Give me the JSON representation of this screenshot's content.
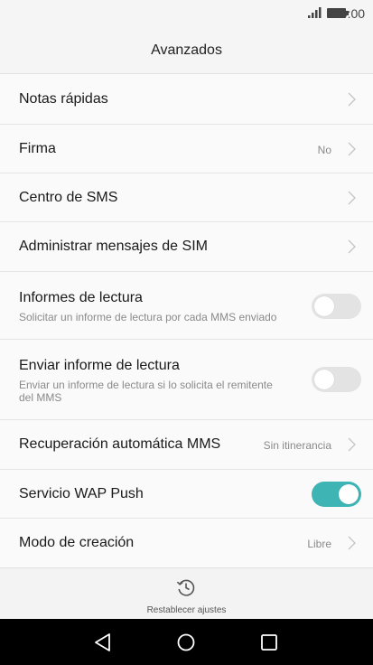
{
  "status_bar": {
    "time": "10:00"
  },
  "header": {
    "title": "Avanzados"
  },
  "settings": {
    "notas": {
      "label": "Notas rápidas"
    },
    "firma": {
      "label": "Firma",
      "value": "No"
    },
    "centro_sms": {
      "label": "Centro de SMS"
    },
    "admin_sim": {
      "label": "Administrar mensajes de SIM"
    },
    "informes": {
      "label": "Informes de lectura",
      "description": "Solicitar un informe de lectura por cada MMS enviado",
      "enabled": false
    },
    "enviar_informe": {
      "label": "Enviar informe de lectura",
      "description": "Enviar un informe de lectura si lo solicita el remitente del MMS",
      "enabled": false
    },
    "recuperacion": {
      "label": "Recuperación automática MMS",
      "value": "Sin itinerancia"
    },
    "wap_push": {
      "label": "Servicio WAP Push",
      "enabled": true
    },
    "modo_creacion": {
      "label": "Modo de creación",
      "value": "Libre"
    }
  },
  "footer": {
    "reset_label": "Restablecer ajustes"
  },
  "colors": {
    "accent": "#3eb4b4",
    "toggle_off": "#e3e3e3"
  },
  "icons": [
    "signal-icon",
    "battery-icon",
    "chevron-right-icon",
    "reset-history-icon",
    "back-icon",
    "home-icon",
    "recent-apps-icon"
  ]
}
